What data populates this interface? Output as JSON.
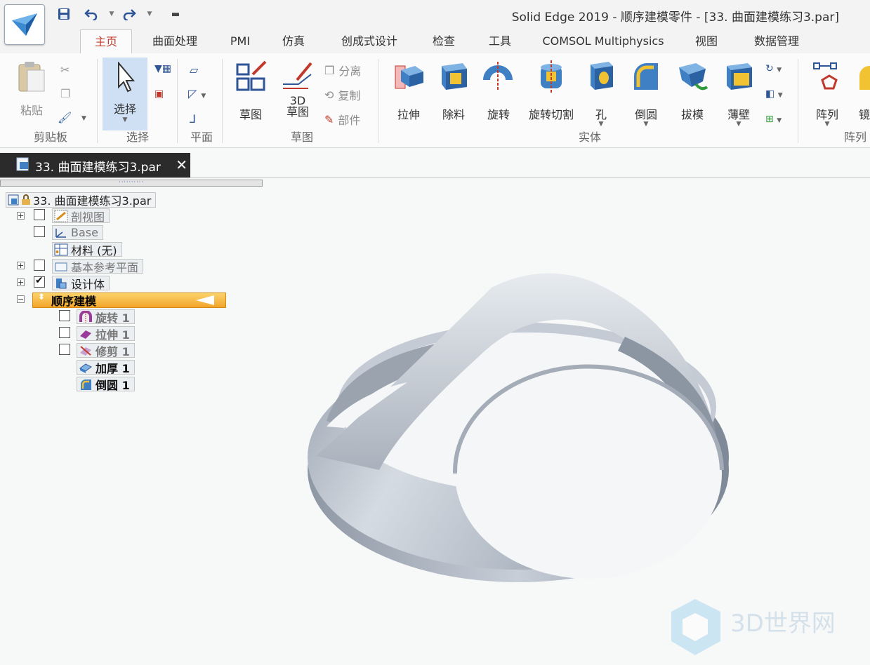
{
  "window": {
    "title": "Solid Edge 2019 - 顺序建模零件 - [33. 曲面建模练习3.par]"
  },
  "quick_access": {
    "save_icon": "save-icon",
    "undo_icon": "undo-icon",
    "redo_icon": "redo-icon",
    "customize_icon": "customize-icon"
  },
  "tabs": [
    {
      "label": "主页",
      "active": true
    },
    {
      "label": "曲面处理"
    },
    {
      "label": "PMI"
    },
    {
      "label": "仿真"
    },
    {
      "label": "创成式设计"
    },
    {
      "label": "检查"
    },
    {
      "label": "工具"
    },
    {
      "label": "COMSOL Multiphysics"
    },
    {
      "label": "视图"
    },
    {
      "label": "数据管理"
    }
  ],
  "ribbon": {
    "clipboard": {
      "paste": "粘贴",
      "group": "剪贴板"
    },
    "select": {
      "label": "选择",
      "group": "选择"
    },
    "plane": {
      "group": "平面"
    },
    "sketch": {
      "sketch": "草图",
      "sketch3d_line1": "3D",
      "sketch3d_line2": "草图",
      "split": "分离",
      "copy": "复制",
      "part": "部件",
      "group": "草图"
    },
    "solids": {
      "extrude": "拉伸",
      "cutout": "除料",
      "revolve": "旋转",
      "revolved_cutout": "旋转切割",
      "hole": "孔",
      "round": "倒圆",
      "draft": "拔模",
      "thin_wall": "薄壁",
      "group": "实体"
    },
    "pattern": {
      "pattern": "阵列",
      "mirror": "镜",
      "group": "阵列"
    }
  },
  "document_tab": {
    "filename": "33. 曲面建模练习3.par",
    "close": "✕"
  },
  "tree": {
    "root": "33. 曲面建模练习3.par",
    "items": [
      {
        "label": "剖视图",
        "checked": false
      },
      {
        "label": "Base",
        "checked": false
      },
      {
        "label": "材料 (无)"
      },
      {
        "label": "基本参考平面",
        "checked": false
      },
      {
        "label": "设计体",
        "checked": true
      },
      {
        "label": "顺序建模"
      },
      {
        "label": "旋转 1",
        "checked": false
      },
      {
        "label": "拉伸 1",
        "checked": false
      },
      {
        "label": "修剪 1",
        "checked": false
      },
      {
        "label": "加厚 1"
      },
      {
        "label": "倒圆 1"
      }
    ]
  },
  "watermark": "3D世界网",
  "colors": {
    "accent_tab": "#c0392b",
    "seq_highlight": "#f5b335",
    "select_highlight": "#cfe0f4",
    "model_fill": "#b8c0cb"
  }
}
